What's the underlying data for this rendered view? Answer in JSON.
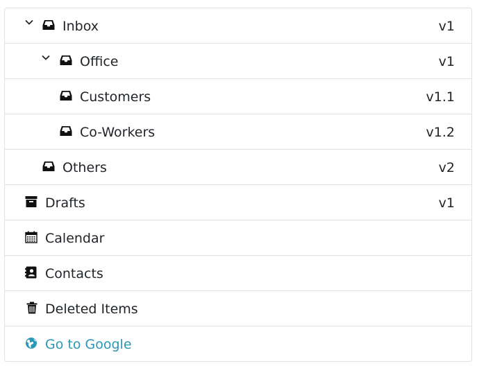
{
  "tree": {
    "items": [
      {
        "label": "Inbox",
        "badge": "v1"
      },
      {
        "label": "Office",
        "badge": "v1"
      },
      {
        "label": "Customers",
        "badge": "v1.1"
      },
      {
        "label": "Co-Workers",
        "badge": "v1.2"
      },
      {
        "label": "Others",
        "badge": "v2"
      },
      {
        "label": "Drafts",
        "badge": "v1"
      },
      {
        "label": "Calendar"
      },
      {
        "label": "Contacts"
      },
      {
        "label": "Deleted Items"
      },
      {
        "label": "Go to Google"
      }
    ]
  },
  "icons": {
    "expanded": "chevron-down-icon",
    "folder": "inbox-tray-icon",
    "drafts": "archive-box-icon",
    "calendar": "calendar-icon",
    "contacts": "address-book-icon",
    "trash": "trash-icon",
    "link": "globe-icon"
  },
  "colors": {
    "link": "#2a96b8",
    "border": "#dee2e6",
    "text": "#212529"
  }
}
